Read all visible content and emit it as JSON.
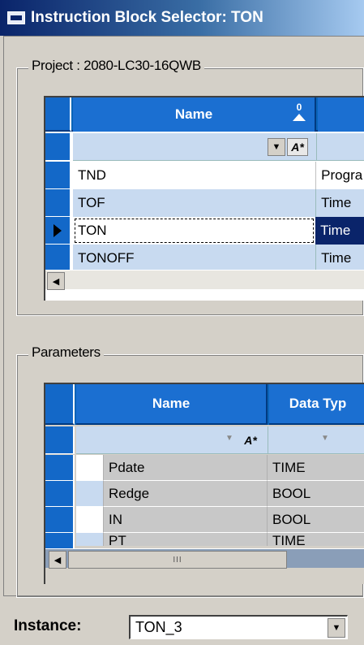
{
  "window": {
    "title": "Instruction Block Selector: TON"
  },
  "project": {
    "legend": "Project : 2080-LC30-16QWB",
    "columns": [
      "Name",
      ""
    ],
    "sort_indicator": "0",
    "rows": [
      {
        "name": "TND",
        "category": "Progra"
      },
      {
        "name": "TOF",
        "category": "Time"
      },
      {
        "name": "TON",
        "category": "Time"
      },
      {
        "name": "TONOFF",
        "category": "Time"
      }
    ],
    "selected_row": 2
  },
  "parameters": {
    "legend": "Parameters",
    "columns": [
      "Name",
      "Data Typ"
    ],
    "rows": [
      {
        "name": "Pdate",
        "type": "TIME"
      },
      {
        "name": "Redge",
        "type": "BOOL"
      },
      {
        "name": "IN",
        "type": "BOOL"
      },
      {
        "name": "PT",
        "type": "TIME"
      }
    ],
    "scroll_thumb_label": "III"
  },
  "instance": {
    "label": "Instance:",
    "value": "TON_3"
  },
  "icons": {
    "app": "instruction-block-icon",
    "sort": "sort-ascending-icon",
    "filter_dropdown": "chevron-down-icon",
    "filter": "filter-icon",
    "row_pointer": "row-pointer-icon",
    "scroll_left": "scroll-left-icon"
  },
  "colors": {
    "title_bar": "#0a246a",
    "grid_header": "#1b6fd1",
    "row_alt": "#c8daf0",
    "row_selected": "#0a246a",
    "window_bg": "#d4d0c8"
  }
}
